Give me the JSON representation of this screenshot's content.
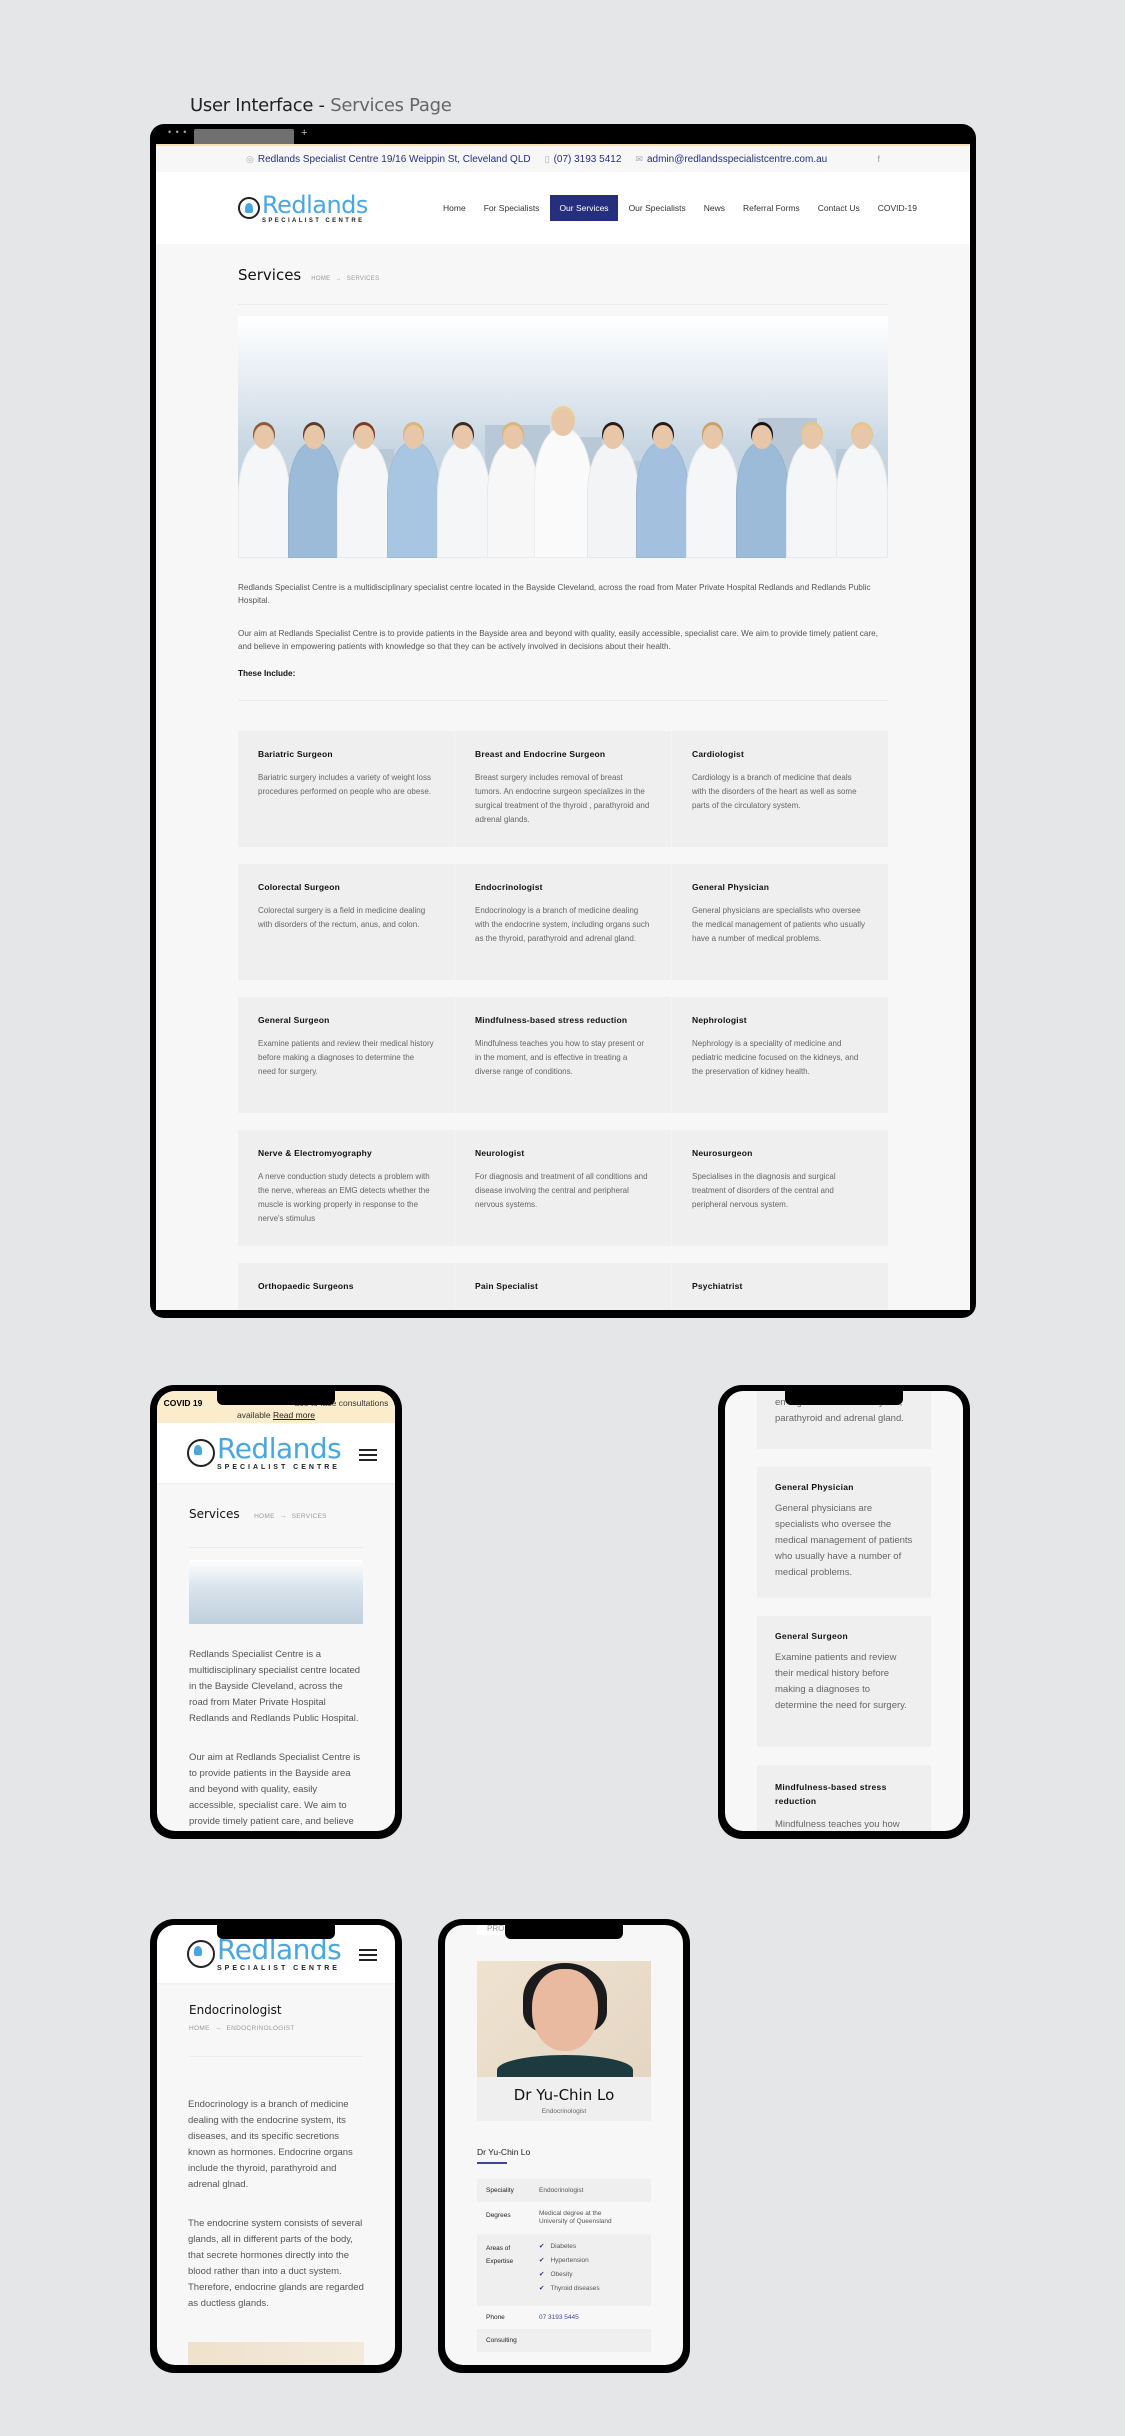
{
  "presentation": {
    "title_main": "User Interface -",
    "title_sub": "Services Page"
  },
  "browser": {
    "window_dots": "• • •",
    "new_tab": "+"
  },
  "colors": {
    "brand_navy": "#262f7d",
    "brand_blue": "#4aa6e0",
    "covid_banner": "#fbedcb",
    "card_bg": "#efefef",
    "page_bg": "#f7f7f7"
  },
  "topbar": {
    "address": "Redlands Specialist Centre 19/16 Weippin St, Cleveland QLD",
    "phone": "(07) 3193 5412",
    "email": "admin@redlandsspecialistcentre.com.au",
    "icons": {
      "address": "map-pin-icon",
      "phone": "phone-icon",
      "email": "mail-icon",
      "social": "facebook-icon"
    },
    "social": "f"
  },
  "logo": {
    "name": "Redlands",
    "tagline": "SPECIALIST CENTRE"
  },
  "nav": {
    "items": [
      {
        "label": "Home"
      },
      {
        "label": "For Specialists"
      },
      {
        "label": "Our Services",
        "active": true
      },
      {
        "label": "Our Specialists"
      },
      {
        "label": "News"
      },
      {
        "label": "Referral Forms"
      },
      {
        "label": "Contact Us"
      },
      {
        "label": "COVID-19"
      }
    ]
  },
  "page": {
    "title": "Services",
    "breadcrumb": {
      "home": "HOME",
      "arrow": "→",
      "current": "SERVICES"
    },
    "hero_alt": "Team of doctors and nurses in front of city skyline",
    "intro_1": "Redlands Specialist Centre is a multidisciplinary specialist centre located in the Bayside Cleveland, across the road from Mater Private Hospital Redlands and Redlands Public Hospital.",
    "intro_2": "Our aim at Redlands Specialist Centre is to provide patients in the Bayside area and beyond with quality, easily accessible, specialist care. We aim to provide timely patient care, and believe in empowering patients with knowledge so that they can be actively involved in decisions about their health.",
    "includes_label": "These Include:"
  },
  "services": [
    {
      "name": "Bariatric Surgeon",
      "desc": "Bariatric surgery includes a variety of weight loss procedures performed on people who are obese."
    },
    {
      "name": "Breast and Endocrine Surgeon",
      "desc": "Breast surgery includes removal of breast tumors. An endocrine surgeon specializes in the surgical treatment of the thyroid , parathyroid  and adrenal glands."
    },
    {
      "name": "Cardiologist",
      "desc": "Cardiology is a branch of medicine that deals with the disorders of the heart as well as some parts of the circulatory system."
    },
    {
      "name": "Colorectal Surgeon",
      "desc": "Colorectal surgery is a field in medicine dealing with disorders of the rectum, anus, and colon."
    },
    {
      "name": "Endocrinologist",
      "desc": "Endocrinology is a branch of medicine dealing with the endocrine system, including organs such as the thyroid, parathyroid and adrenal gland."
    },
    {
      "name": "General Physician",
      "desc": "General physicians are specialists who oversee the medical management of patients who usually have a number of medical problems."
    },
    {
      "name": "General Surgeon",
      "desc": "Examine patients and review their medical history before making a diagnoses to determine the need for surgery."
    },
    {
      "name": "Mindfulness-based stress reduction",
      "desc": "Mindfulness teaches you how to stay present or in the moment, and is effective in treating a diverse range of conditions."
    },
    {
      "name": "Nephrologist",
      "desc": "Nephrology is a speciality of medicine and pediatric medicine focused on the kidneys, and the preservation of kidney health."
    },
    {
      "name": "Nerve & Electromyography",
      "desc": "A nerve conduction study detects a problem with the nerve, whereas an EMG detects whether the muscle is working properly in response to the nerve's stimulus"
    },
    {
      "name": "Neurologist",
      "desc": "For diagnosis and treatment of all conditions and disease involving the central and peripheral nervous systems."
    },
    {
      "name": "Neurosurgeon",
      "desc": "Specialises in the diagnosis and surgical treatment of disorders of the central and peripheral nervous system."
    },
    {
      "name": "Orthopaedic Surgeons",
      "desc": ""
    },
    {
      "name": "Pain Specialist",
      "desc": ""
    },
    {
      "name": "Psychiatrist",
      "desc": ""
    }
  ],
  "mobile_1": {
    "covid_bold": "COVID 19",
    "covid_text": "ace to face consultations available",
    "covid_link": "Read more",
    "title": "Services",
    "intro_1": "Redlands Specialist Centre is a multidisciplinary specialist centre located in the Bayside Cleveland, across the road from Mater Private Hospital Redlands and Redlands Public Hospital.",
    "intro_2": "Our aim at Redlands Specialist Centre is to provide patients in the Bayside area and beyond with quality, easily accessible, specialist care. We aim to provide timely patient care, and believe in empowering patients with knowledge"
  },
  "mobile_2": {
    "partial_text": "en organs such as the thyroid, parathyroid and adrenal gland.",
    "cards": [
      {
        "name": "General Physician",
        "desc": "General physicians are specialists who oversee the medical management of patients who usually have a number of medical problems."
      },
      {
        "name": "General Surgeon",
        "desc": "Examine patients and review their medical history before making a diagnoses to determine the need for surgery."
      },
      {
        "name": "Mindfulness-based stress reduction",
        "desc": "Mindfulness teaches you how"
      }
    ]
  },
  "mobile_3": {
    "title": "Endocrinologist",
    "breadcrumb": {
      "home": "HOME",
      "arrow": "→",
      "current": "ENDOCRINOLOGIST"
    },
    "para_1": "Endocrinology is a branch of medicine dealing with the endocrine system, its diseases, and its specific secretions known as hormones. Endocrine organs include the thyroid, parathyroid and adrenal glnad.",
    "para_2": "The endocrine system consists of several glands, all in different parts of the body, that secrete hormones directly into the blood rather than into a duct system. Therefore, endocrine glands are regarded as ductless glands."
  },
  "mobile_4": {
    "top_partial": "PRO",
    "name": "Dr Yu-Chin Lo",
    "speciality": "Endocrinologist",
    "section_title": "Dr Yu-Chin Lo",
    "table": {
      "speciality_label": "Speciality",
      "speciality_value": "Endocrinologist",
      "degrees_label": "Degrees",
      "degrees_value": "Medical degree at the University of Queensland",
      "areas_label": "Areas of Expertise",
      "areas": [
        "Diabetes",
        "Hypertension",
        "Obesity",
        "Thyroid diseases"
      ],
      "phone_label": "Phone",
      "phone_value": "07 3193 5445",
      "consulting_label": "Consulting"
    }
  }
}
